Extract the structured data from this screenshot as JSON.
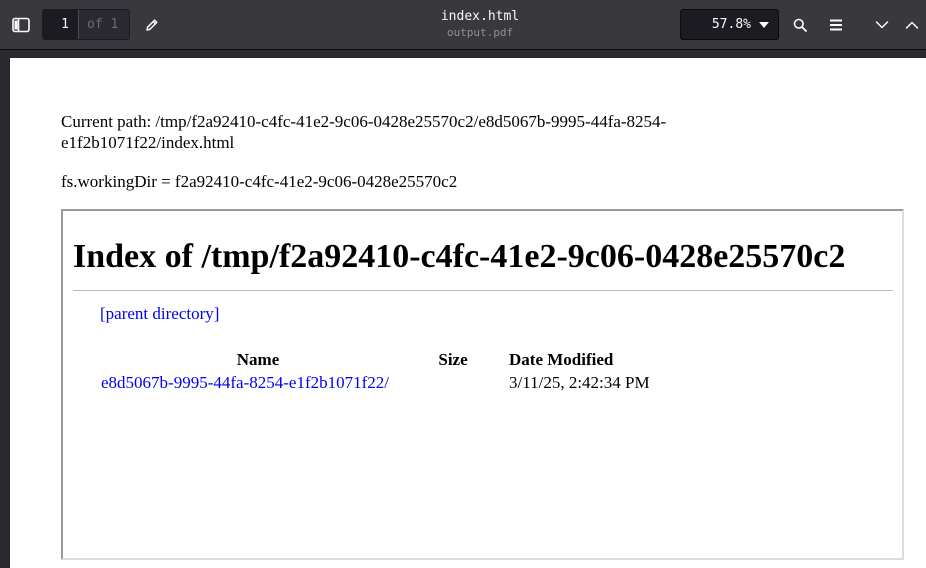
{
  "toolbar": {
    "page_number": "1",
    "page_of": "of 1",
    "title": "index.html",
    "subtitle": "output.pdf",
    "zoom": "57.8%"
  },
  "document": {
    "current_path": "Current path: /tmp/f2a92410-c4fc-41e2-9c06-0428e25570c2/e8d5067b-9995-44fa-8254-e1f2b1071f22/index.html",
    "working_dir": "fs.workingDir = f2a92410-c4fc-41e2-9c06-0428e25570c2",
    "index_title": "Index of /tmp/f2a92410-c4fc-41e2-9c06-0428e25570c2",
    "parent_link": "[parent directory]",
    "columns": {
      "name": "Name",
      "size": "Size",
      "date": "Date Modified"
    },
    "rows": [
      {
        "name": "e8d5067b-9995-44fa-8254-e1f2b1071f22/",
        "size": "",
        "date": "3/11/25, 2:42:34 PM"
      }
    ]
  },
  "colors": {
    "toolbar_bg": "#38383d",
    "viewport_bg": "#2a2a2e",
    "link": "#0000ee"
  },
  "icons": {
    "sidebar_toggle": "sidebar-toggle-icon",
    "annotate": "pen-icon",
    "zoom_dropdown": "caret-down-icon",
    "find": "search-icon",
    "tools_menu": "hamburger-menu-icon",
    "next": "chevron-down-icon",
    "previous": "chevron-up-icon"
  }
}
